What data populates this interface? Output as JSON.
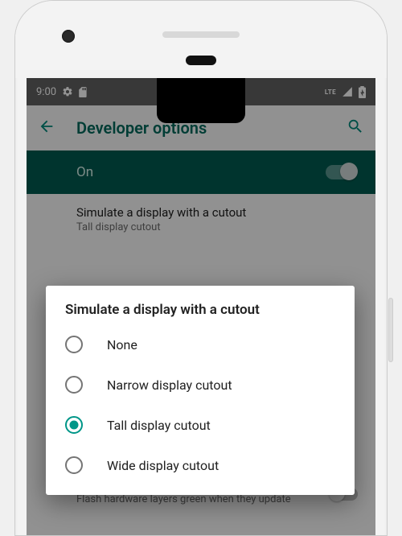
{
  "status": {
    "time": "9:00",
    "lte": "LTE"
  },
  "appbar": {
    "title": "Developer options"
  },
  "toggle": {
    "label": "On",
    "checked": true
  },
  "setting": {
    "title": "Simulate a display with a cutout",
    "subtitle": "Tall display cutout"
  },
  "partial": {
    "text": "Flash hardware layers green when they update"
  },
  "dialog": {
    "title": "Simulate a display with a cutout",
    "options": [
      {
        "label": "None",
        "selected": false
      },
      {
        "label": "Narrow display cutout",
        "selected": false
      },
      {
        "label": "Tall display cutout",
        "selected": true
      },
      {
        "label": "Wide display cutout",
        "selected": false
      }
    ]
  },
  "colors": {
    "accent": "#009688",
    "toolbar_bg": "#005b50"
  }
}
